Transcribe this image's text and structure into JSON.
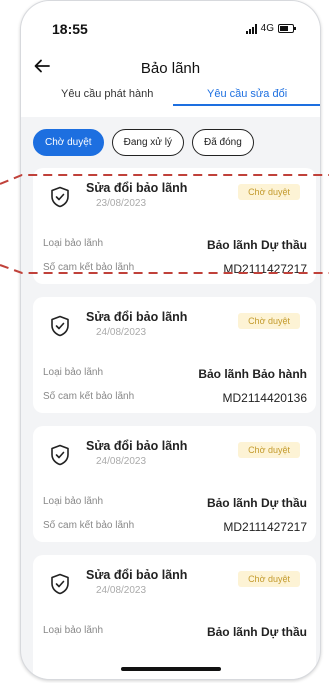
{
  "status": {
    "time": "18:55",
    "network": "4G"
  },
  "header": {
    "title": "Bảo lãnh"
  },
  "tabs": [
    {
      "label": "Yêu cầu phát hành"
    },
    {
      "label": "Yêu cầu sửa đổi"
    }
  ],
  "filters": [
    {
      "label": "Chờ duyệt"
    },
    {
      "label": "Đang xử lý"
    },
    {
      "label": "Đã đóng"
    }
  ],
  "cards": [
    {
      "title": "Sửa đổi bảo lãnh",
      "date": "23/08/2023",
      "status": "Chờ duyệt",
      "type_label": "Loại bảo lãnh",
      "type_value": "Bảo lãnh Dự thầu",
      "number_label": "Số cam kết bảo lãnh",
      "number_value": "MD2111427217"
    },
    {
      "title": "Sửa đổi bảo lãnh",
      "date": "24/08/2023",
      "status": "Chờ duyệt",
      "type_label": "Loại bảo lãnh",
      "type_value": "Bảo lãnh Bảo hành",
      "number_label": "Số cam kết bảo lãnh",
      "number_value": "MD2114420136"
    },
    {
      "title": "Sửa đổi bảo lãnh",
      "date": "24/08/2023",
      "status": "Chờ duyệt",
      "type_label": "Loại bảo lãnh",
      "type_value": "Bảo lãnh Dự thầu",
      "number_label": "Số cam kết bảo lãnh",
      "number_value": "MD2111427217"
    },
    {
      "title": "Sửa đổi bảo lãnh",
      "date": "24/08/2023",
      "status": "Chờ duyệt",
      "type_label": "Loại bảo lãnh",
      "type_value": "Bảo lãnh Dự thầu"
    }
  ],
  "colors": {
    "accent": "#1d6fe0",
    "badge_bg": "#fdf3d5",
    "badge_text": "#c39a2c",
    "highlight": "#c0413a"
  },
  "icons": {
    "back": "arrow-left-icon",
    "card": "shield-check-icon"
  }
}
